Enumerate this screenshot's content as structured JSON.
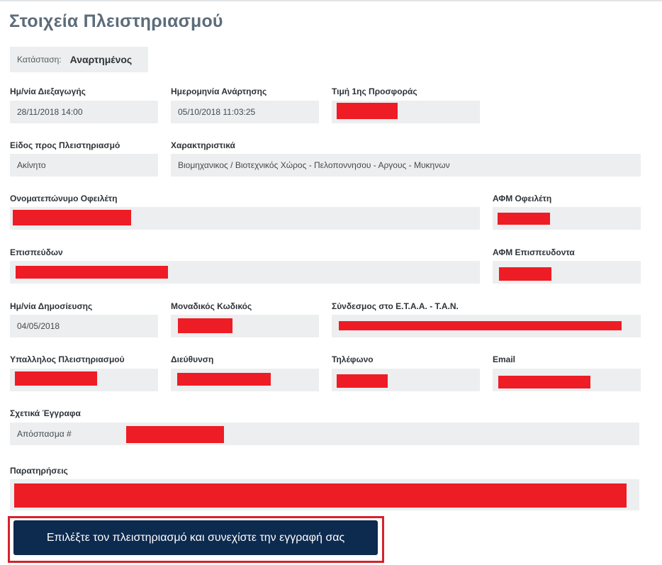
{
  "page": {
    "title": "Στοιχεία Πλειστηριασμού"
  },
  "status": {
    "label": "Κατάσταση:",
    "value": "Αναρτημένος"
  },
  "fields": {
    "auction_date": {
      "label": "Ημ/νία Διεξαγωγής",
      "value": "28/11/2018 14:00"
    },
    "posting_date": {
      "label": "Ημερομηνία Ανάρτησης",
      "value": "05/10/2018 11:03:25"
    },
    "first_offer_price": {
      "label": "Τιμή 1ης Προσφοράς",
      "value": ""
    },
    "item_type": {
      "label": "Είδος προς Πλειστηριασμό",
      "value": "Ακίνητο"
    },
    "characteristics": {
      "label": "Χαρακτηριστικά",
      "value": "Βιομηχανικος / Βιοτεχνικός Χώρος - Πελοποννησου - Αργους - Μυκηνων"
    },
    "debtor_name": {
      "label": "Ονοματεπώνυμο Οφειλέτη",
      "value": ""
    },
    "debtor_vat": {
      "label": "ΑΦΜ Οφειλέτη",
      "value": ""
    },
    "pursuer": {
      "label": "Επισπεύδων",
      "value": ""
    },
    "pursuer_vat": {
      "label": "ΑΦΜ Επισπευδοντα",
      "value": ""
    },
    "publication_date": {
      "label": "Ημ/νία Δημοσίευσης",
      "value": "04/05/2018"
    },
    "unique_code": {
      "label": "Μοναδικός Κωδικός",
      "value": ""
    },
    "etaa_link": {
      "label": "Σύνδεσμος στο Ε.Τ.Α.Α. - Τ.Α.Ν.",
      "value": ""
    },
    "auction_officer": {
      "label": "Υπαλληλος Πλειστηριασμού",
      "value": ""
    },
    "address": {
      "label": "Διεύθυνση",
      "value": ""
    },
    "phone": {
      "label": "Τηλέφωνο",
      "value": ""
    },
    "email": {
      "label": "Email",
      "value": ""
    },
    "documents": {
      "label": "Σχετικά Έγγραφα",
      "value": "Απόσπασμα #"
    },
    "remarks": {
      "label": "Παρατηρήσεις",
      "value": ""
    }
  },
  "cta": {
    "label": "Επιλέξτε τον πλειστηριασμό και συνεχίστε την εγγραφή σας"
  },
  "colors": {
    "title": "#5c6c7a",
    "field_bg": "#eceeef",
    "redaction": "#ee1c25",
    "button_bg": "#0d2a4f",
    "highlight_frame": "#d6222a"
  }
}
